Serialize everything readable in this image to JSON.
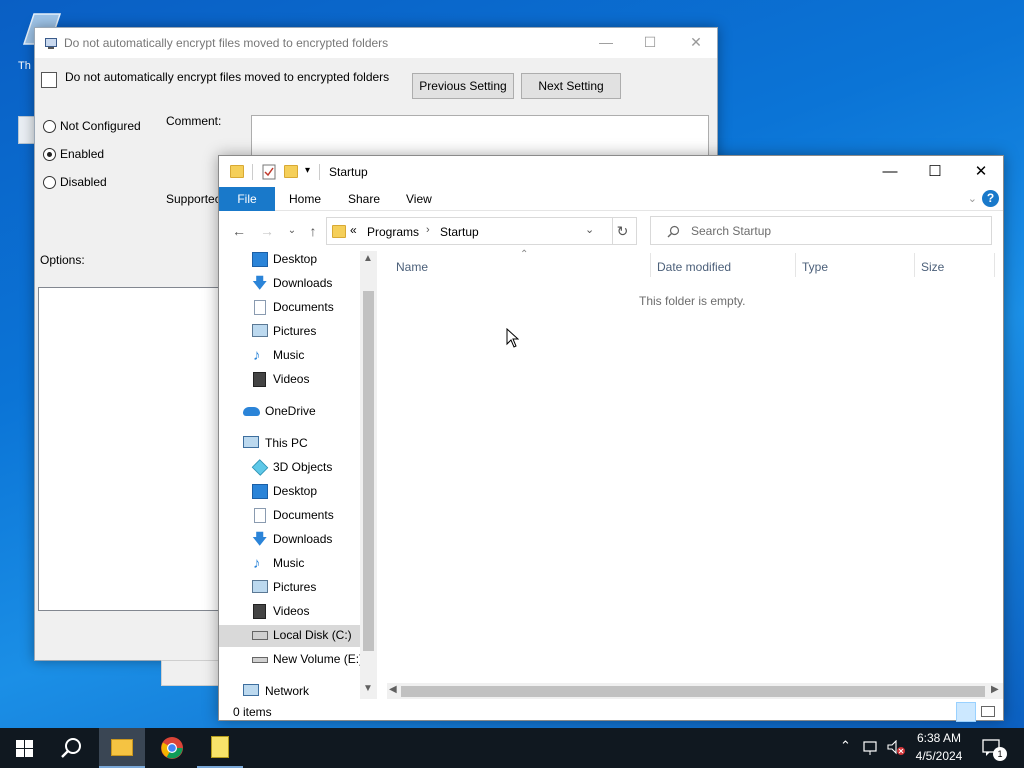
{
  "desktop": {
    "icon_label": "Th"
  },
  "policy_window": {
    "title": "Do not automatically encrypt files moved to encrypted folders",
    "header": "Do not automatically encrypt files moved to encrypted folders",
    "previous_button": "Previous Setting",
    "next_button": "Next Setting",
    "radio_not_configured": "Not Configured",
    "radio_enabled": "Enabled",
    "radio_disabled": "Disabled",
    "selected_state": "Enabled",
    "comment_label": "Comment:",
    "supported_label": "Supportec",
    "options_label": "Options:"
  },
  "explorer": {
    "title": "Startup",
    "ribbon_tabs": [
      "File",
      "Home",
      "Share",
      "View"
    ],
    "address": {
      "overflow": "«",
      "crumbs": [
        "Programs",
        "Startup"
      ]
    },
    "search_placeholder": "Search Startup",
    "nav": {
      "quick_access": [
        {
          "label": "Desktop",
          "icon": "desktop-icon",
          "pinned": true
        },
        {
          "label": "Downloads",
          "icon": "downloads-icon",
          "pinned": true
        },
        {
          "label": "Documents",
          "icon": "documents-icon",
          "pinned": true
        },
        {
          "label": "Pictures",
          "icon": "pictures-icon",
          "pinned": true
        },
        {
          "label": "Music",
          "icon": "music-icon",
          "pinned": false
        },
        {
          "label": "Videos",
          "icon": "videos-icon",
          "pinned": false
        }
      ],
      "onedrive": "OneDrive",
      "this_pc": "This PC",
      "this_pc_items": [
        {
          "label": "3D Objects",
          "icon": "3d-objects-icon"
        },
        {
          "label": "Desktop",
          "icon": "desktop-icon"
        },
        {
          "label": "Documents",
          "icon": "documents-icon"
        },
        {
          "label": "Downloads",
          "icon": "downloads-icon"
        },
        {
          "label": "Music",
          "icon": "music-icon"
        },
        {
          "label": "Pictures",
          "icon": "pictures-icon"
        },
        {
          "label": "Videos",
          "icon": "videos-icon"
        },
        {
          "label": "Local Disk (C:)",
          "icon": "drive-icon",
          "selected": true
        },
        {
          "label": "New Volume (E:)",
          "icon": "drive-icon"
        }
      ],
      "network": "Network"
    },
    "columns": [
      "Name",
      "Date modified",
      "Type",
      "Size"
    ],
    "empty_message": "This folder is empty.",
    "status": "0 items"
  },
  "taskbar": {
    "time": "6:38 AM",
    "date": "4/5/2024",
    "notification_count": "1"
  },
  "colors": {
    "accent": "#1979ca",
    "taskbar": "#101820"
  }
}
